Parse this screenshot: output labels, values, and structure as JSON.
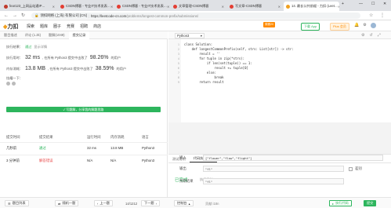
{
  "browser": {
    "tabs": [
      {
        "label": "fear123_上网云站通IP…",
        "color": "#c0392b"
      },
      {
        "label": "CSDN博客 - 专业IT技术发表…",
        "color": "#e33e33"
      },
      {
        "label": "CSDN博客 - 专业IT技术发表…",
        "color": "#e33e33"
      },
      {
        "label": "文章管理-CSDN博客",
        "color": "#e33e33"
      },
      {
        "label": "写文章-CSDN博客",
        "color": "#e33e33"
      },
      {
        "label": "14. 最长公共前缀 - 力扣 (Leet…",
        "color": "#f0a020"
      }
    ],
    "secure_label": "领扣网络 (上海) 有限公司 [CN]",
    "url_host": "https://leetcode-cn.com",
    "url_path": "/problems/longest-common-prefix/submissions/"
  },
  "site": {
    "logo_text": "力扣",
    "nav": [
      "探索",
      "题库",
      "圈子",
      "竞赛",
      "招聘",
      "商店"
    ],
    "contest_badge": "周赛20",
    "app_button": "下载 App",
    "plus_button": "Plus 会员",
    "right_icons": [
      "bell-icon",
      "settings-icon",
      "avatar"
    ]
  },
  "left": {
    "subtabs": [
      "题目描述",
      "评论 (1.2k)",
      "题解(1049)",
      "提交记录"
    ],
    "active_subtab": 3,
    "status_label": "执行结果：",
    "status_value": "通过",
    "show_details": "显示详情",
    "runtime_label": "执行用时：",
    "runtime_value": "32 ms",
    "runtime_text": ", 在所有 Python3 提交中击败了",
    "runtime_pct": "98.26%",
    "users_suffix": "的用户",
    "memory_label": "内存消耗：",
    "memory_value": "13.8 MB",
    "memory_text": ", 在所有 Python3 提交中击败了",
    "memory_pct": "38.59%",
    "progress_label": "炫耀一下：",
    "share_button": "✓ 写题解，分享我的解题思路",
    "table": {
      "headers": [
        "提交时间",
        "提交结果",
        "运行时间",
        "内存消耗",
        "语言"
      ],
      "rows": [
        [
          "几秒前",
          "通过",
          "32 ms",
          "13.8 MB",
          "Python3"
        ],
        [
          "3 分钟前",
          "解答错误",
          "N/A",
          "N/A",
          "Python3"
        ]
      ]
    }
  },
  "editor": {
    "language": "Python3",
    "code_lines": [
      {
        "n": "1",
        "text": "class Solution:"
      },
      {
        "n": "2",
        "text": "    def longestCommonPrefix(self, strs: List[str]) -> str:"
      },
      {
        "n": "3",
        "text": "        result = ''"
      },
      {
        "n": "4",
        "text": "        for tuple in zip(*strs):"
      },
      {
        "n": "5",
        "text": "            if len(set(tuple)) == 1:"
      },
      {
        "n": "6",
        "text": "                result += tuple[0]"
      },
      {
        "n": "7",
        "text": "            else:"
      },
      {
        "n": "8",
        "text": "                break"
      },
      {
        "n": "9",
        "text": "        return result"
      }
    ],
    "console_tabs": [
      "测试用例",
      "代码执行结果",
      "调试器"
    ],
    "active_console_tab": 1,
    "finished_label": "已完成",
    "exec_time": "执行用时：28 ms",
    "input_label": "输入",
    "input_value": "[\"flower\",\"flow\",\"flight\"]",
    "output_label": "输出",
    "output_value": "\"fl\"",
    "diff_label": "差别",
    "expected_label": "预期结果",
    "expected_value": "\"fl\""
  },
  "bottom": {
    "question_list": "题目列表",
    "random": "随机一题",
    "prev": "上一题",
    "page": "14/1212",
    "next": "下一题",
    "console": "控制台",
    "contribute": "贡献 i18n",
    "run_code": "执行代码",
    "submit": "提交"
  }
}
